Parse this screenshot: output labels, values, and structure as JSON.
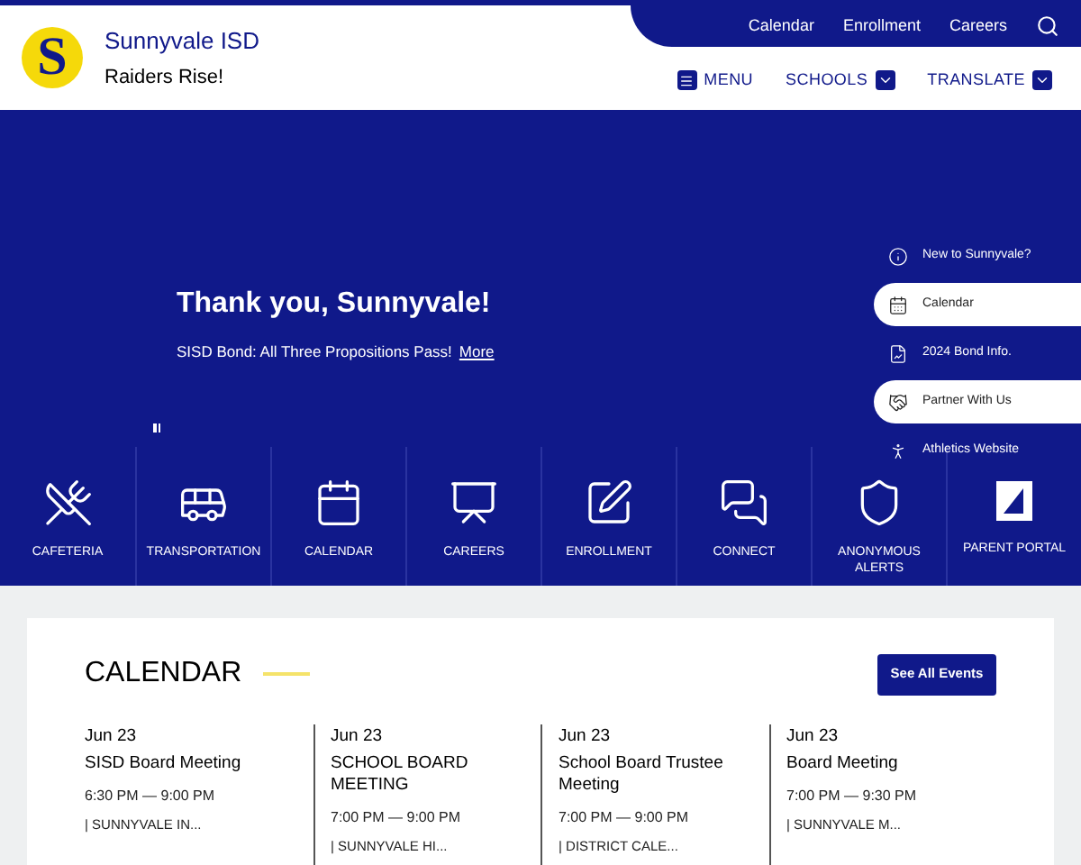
{
  "header": {
    "school_name": "Sunnyvale ISD",
    "tagline": "Raiders Rise!",
    "logo_letter": "S",
    "top_links": [
      "Calendar",
      "Enrollment",
      "Careers"
    ],
    "nav": [
      {
        "label": "MENU",
        "kind": "menu"
      },
      {
        "label": "SCHOOLS",
        "kind": "dropdown"
      },
      {
        "label": "TRANSLATE",
        "kind": "dropdown"
      }
    ]
  },
  "hero": {
    "title": "Thank you, Sunnyvale!",
    "text": "SISD Bond: All Three Propositions Pass!",
    "link": "More"
  },
  "side_links": [
    {
      "label": "New to Sunnyvale?",
      "selected": false
    },
    {
      "label": "Calendar",
      "selected": true
    },
    {
      "label": "2024 Bond Info.",
      "selected": false
    },
    {
      "label": "Partner With Us",
      "selected": true
    },
    {
      "label": "Athletics Website",
      "selected": false
    }
  ],
  "quick_links": [
    {
      "label": "CAFETERIA"
    },
    {
      "label": "TRANSPORTATION"
    },
    {
      "label": "CALENDAR"
    },
    {
      "label": "CAREERS"
    },
    {
      "label": "ENROLLMENT"
    },
    {
      "label": "CONNECT"
    },
    {
      "label": "ANONYMOUS ALERTS"
    },
    {
      "label": "PARENT PORTAL"
    }
  ],
  "calendar": {
    "title": "CALENDAR",
    "button": "See All Events",
    "events": [
      {
        "date": "Jun 23",
        "title": "SISD Board Meeting",
        "time": "6:30 PM — 9:00 PM",
        "location": "| SUNNYVALE IN..."
      },
      {
        "date": "Jun 23",
        "title": "SCHOOL BOARD MEETING",
        "time": "7:00 PM — 9:00 PM",
        "location": "| SUNNYVALE HI..."
      },
      {
        "date": "Jun 23",
        "title": "School Board Trustee Meeting",
        "time": "7:00 PM — 9:00 PM",
        "location": "| DISTRICT CALE..."
      },
      {
        "date": "Jun 23",
        "title": "Board Meeting",
        "time": "7:00 PM — 9:30 PM",
        "location": "| SUNNYVALE M..."
      }
    ]
  }
}
